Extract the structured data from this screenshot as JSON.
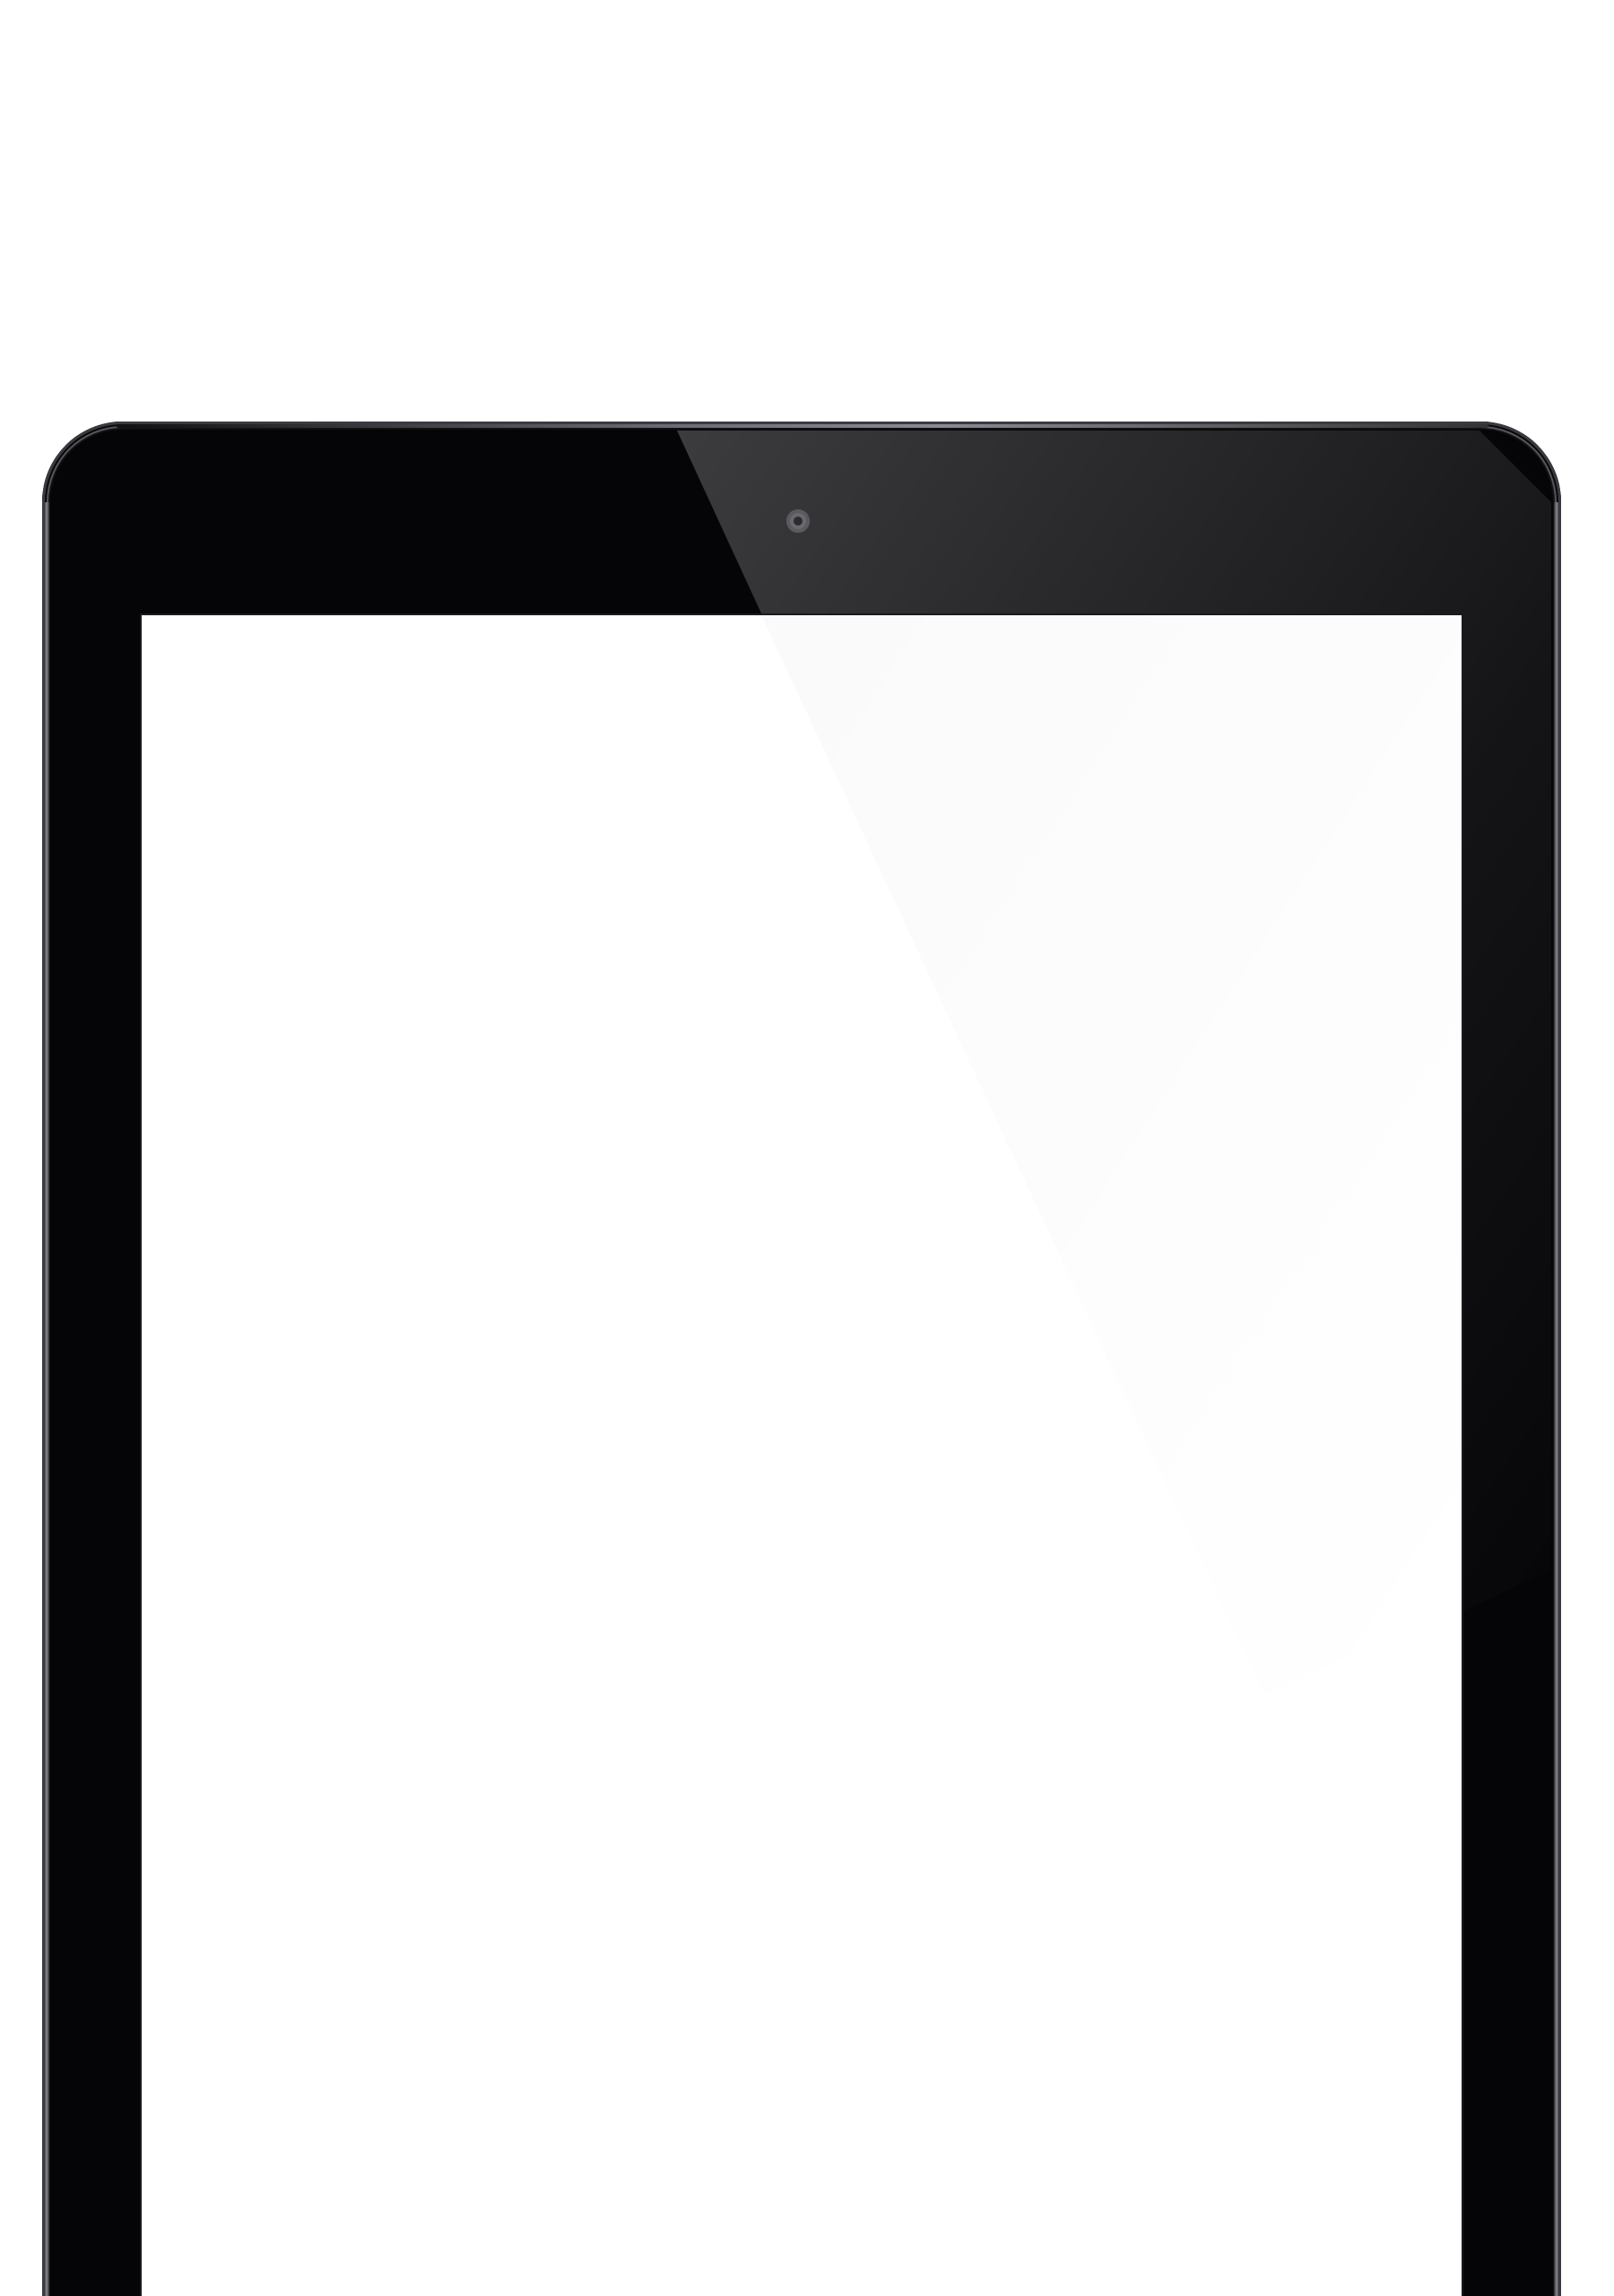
{
  "device": {
    "type": "tablet",
    "bezel_color": "#050508",
    "screen_color": "#ffffff",
    "background_color": "#ffffff",
    "camera_icon": "camera-icon"
  }
}
